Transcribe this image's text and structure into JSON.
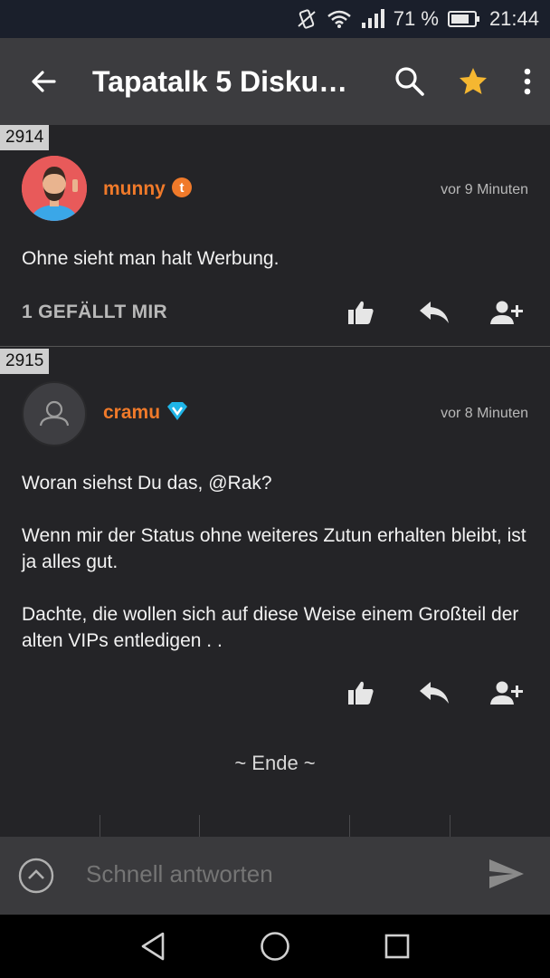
{
  "status_bar": {
    "battery_percent": "71 %",
    "time": "21:44",
    "icons": [
      "vibrate-icon",
      "wifi-icon",
      "signal-icon",
      "battery-icon"
    ]
  },
  "app_bar": {
    "title": "Tapatalk 5 Disku…",
    "icons": [
      "back-arrow-icon",
      "search-icon",
      "star-icon",
      "more-vert-icon"
    ],
    "star_color": "#f5b731"
  },
  "posts": [
    {
      "number": "2914",
      "username": "munny",
      "badge": "t",
      "time": "vor 9 Minuten",
      "paragraphs": [
        "Ohne sieht man halt Werbung."
      ],
      "likes": "1 GEFÄLLT MIR"
    },
    {
      "number": "2915",
      "username": "cramu",
      "badge": "v",
      "time": "vor 8 Minuten",
      "paragraphs": [
        "Woran siehst Du das, @Rak?",
        "Wenn mir der Status ohne weiteres Zutun erhalten bleibt, ist ja alles gut.",
        "Dachte, die wollen sich auf diese Weise einem Großteil der alten VIPs entledigen . ."
      ],
      "likes": ""
    }
  ],
  "end_marker": "~ Ende ~",
  "reply_bar": {
    "placeholder": "Schnell antworten"
  },
  "colors": {
    "accent_username": "#f07a2a",
    "badge_t": "#f07a2a",
    "badge_v": "#1fb5e8",
    "background": "#242427",
    "app_bar": "#3c3c3f"
  }
}
